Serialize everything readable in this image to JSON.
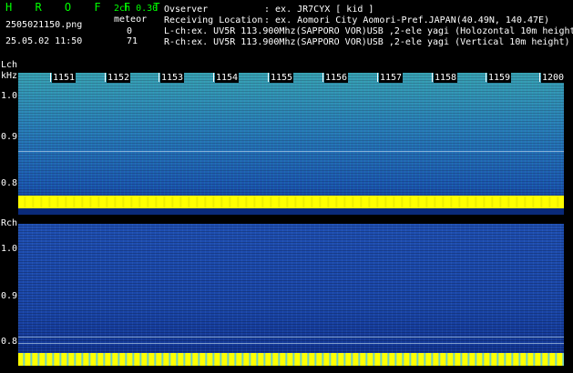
{
  "header": {
    "brand": "H R O F F T",
    "mode": "2ch 0.30",
    "filename": "2505021150.png",
    "meteor_label": "meteor",
    "datetime": "25.05.02 11:50",
    "count_lch": "0",
    "count_rch": "71",
    "observer_label": "Ovserver",
    "observer_value": ": ex. JR7CYX [ kid ]",
    "location_label": "Receiving Location",
    "location_value": ": ex. Aomori City Aomori-Pref.JAPAN(40.49N, 140.47E)",
    "lch_line": "L-ch:ex. UV5R 113.900Mhz(SAPPORO VOR)USB ,2-ele yagi (Holozontal 10m height)",
    "rch_line": "R-ch:ex. UV5R 113.900Mhz(SAPPORO VOR)USB ,2-ele yagi (Vertical 10m height)"
  },
  "top_panel": {
    "channel": "Lch",
    "unit": "kHz",
    "y_labels": [
      "1.0",
      "0.9",
      "0.8"
    ]
  },
  "bottom_panel": {
    "channel": "Rch",
    "y_labels": [
      "1.0",
      "0.9",
      "0.8"
    ]
  },
  "time_ticks": [
    "1151",
    "1152",
    "1153",
    "1154",
    "1155",
    "1156",
    "1157",
    "1158",
    "1159",
    "1200"
  ],
  "colors": {
    "text_green": "#00ff00",
    "text_white": "#ffffff",
    "noise_blue": "#2a62b8",
    "band_yellow": "#ffff00"
  }
}
